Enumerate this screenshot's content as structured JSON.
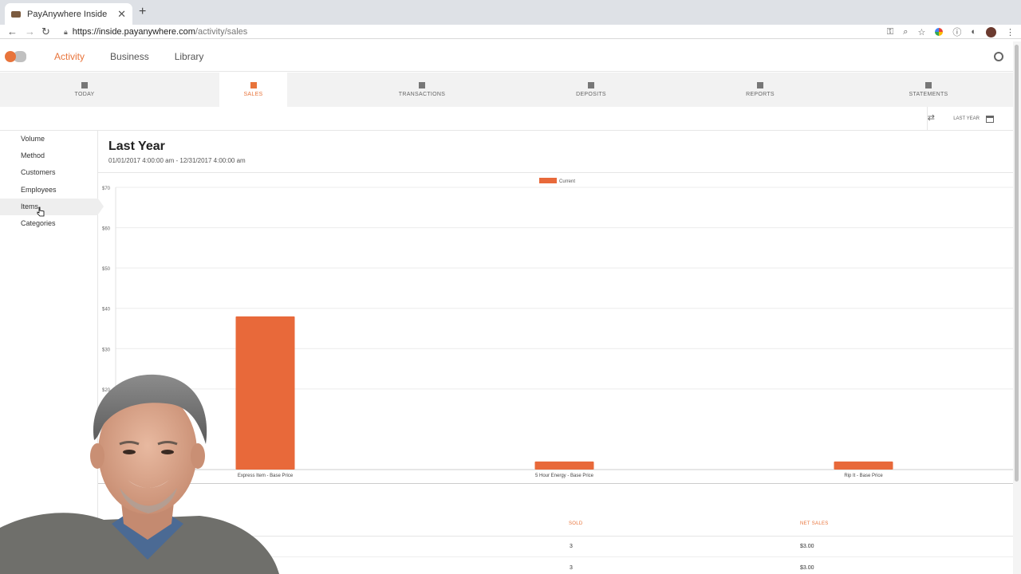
{
  "browser": {
    "tab_title": "PayAnywhere Inside",
    "tab_close": "✕",
    "new_tab": "+",
    "url_host": "https://inside.payanywhere.com",
    "url_path": "/activity/sales"
  },
  "app": {
    "nav": [
      {
        "label": "Activity",
        "active": true
      },
      {
        "label": "Business",
        "active": false
      },
      {
        "label": "Library",
        "active": false
      }
    ]
  },
  "subnav": [
    {
      "label": "TODAY",
      "icon": "dashboard-icon"
    },
    {
      "label": "SALES",
      "icon": "bar-chart-icon",
      "active": true
    },
    {
      "label": "TRANSACTIONS",
      "icon": "list-icon"
    },
    {
      "label": "DEPOSITS",
      "icon": "bank-icon"
    },
    {
      "label": "REPORTS",
      "icon": "report-icon"
    },
    {
      "label": "STATEMENTS",
      "icon": "statement-icon"
    }
  ],
  "filter": {
    "date_range_label": "LAST YEAR"
  },
  "sidebar": {
    "items": [
      {
        "label": "Volume"
      },
      {
        "label": "Method"
      },
      {
        "label": "Customers"
      },
      {
        "label": "Employees"
      },
      {
        "label": "Items",
        "active": true
      },
      {
        "label": "Categories"
      }
    ]
  },
  "main": {
    "title": "Last Year",
    "date_range": "01/01/2017 4:00:00 am - 12/31/2017 4:00:00 am"
  },
  "chart_data": {
    "type": "bar",
    "categories": [
      "Express Item - Base Price",
      "5 Hour Energy - Base Price",
      "Rip It - Base Price"
    ],
    "series": [
      {
        "name": "Current",
        "values": [
          38,
          2,
          2
        ],
        "color": "#e8693a"
      }
    ],
    "y_ticks": [
      "$20",
      "$30",
      "$40",
      "$50",
      "$60",
      "$70"
    ],
    "y_tick_values": [
      20,
      30,
      40,
      50,
      60,
      70
    ],
    "ylim": [
      0,
      70
    ],
    "legend_position": "top-center",
    "grid": true
  },
  "table": {
    "headers": {
      "sold": "SOLD",
      "net_sales": "NET SALES"
    },
    "rows": [
      {
        "sold": "3",
        "net_sales": "$3.00"
      },
      {
        "sold": "3",
        "net_sales": "$3.00"
      }
    ]
  },
  "colors": {
    "accent": "#e8743b",
    "bar": "#e8693a"
  }
}
